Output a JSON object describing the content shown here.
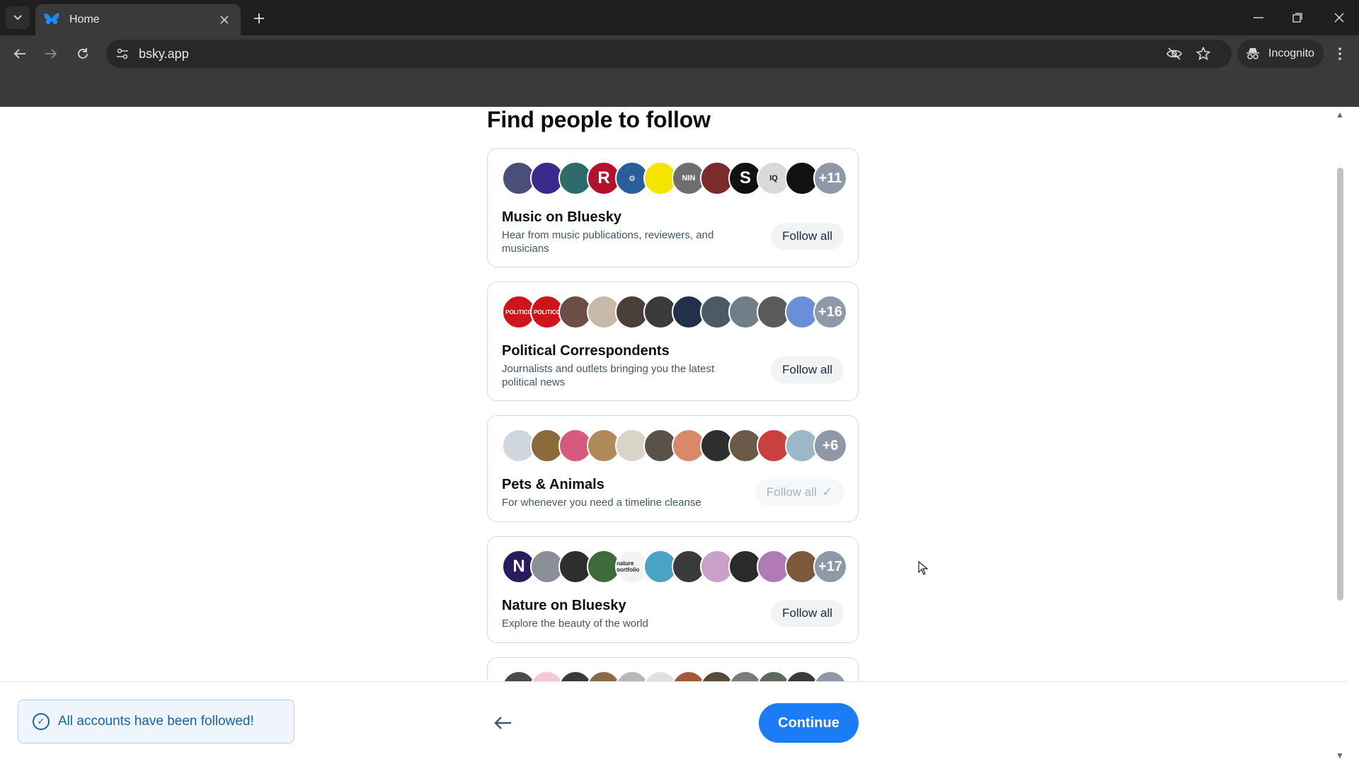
{
  "browser": {
    "tab_title": "Home",
    "url": "bsky.app",
    "incognito_label": "Incognito"
  },
  "page": {
    "heading": "Find people to follow"
  },
  "cards": [
    {
      "title": "Music on Bluesky",
      "description": "Hear from music publications, reviewers, and musicians",
      "more_count": "+11",
      "follow_label": "Follow all",
      "followed": false,
      "avatar_colors": [
        "#4a4f7a",
        "#3b2a8e",
        "#2f6b6a",
        "#b3122e",
        "#2a5e9a",
        "#f5e400",
        "#6e6e6e",
        "#7a2c2c",
        "#111111",
        "#d9d9d9",
        "#111111"
      ],
      "avatar_labels": [
        "",
        "",
        "",
        "R",
        "⚙",
        "",
        "NIN",
        "",
        "S",
        "IQ",
        ""
      ]
    },
    {
      "title": "Political Correspondents",
      "description": "Journalists and outlets bringing you the latest political news",
      "more_count": "+16",
      "follow_label": "Follow all",
      "followed": false,
      "avatar_colors": [
        "#d0141c",
        "#d0141c",
        "#6b4f45",
        "#c9b9a8",
        "#4a3f3a",
        "#3b3b3b",
        "#22304a",
        "#4e5966",
        "#6f7f88",
        "#5a5a5a",
        "#6a8fd8"
      ],
      "avatar_labels": [
        "POLITICO",
        "POLITICO",
        "",
        "",
        "",
        "",
        "",
        "",
        "",
        "",
        ""
      ]
    },
    {
      "title": "Pets & Animals",
      "description": "For whenever you need a timeline cleanse",
      "more_count": "+6",
      "follow_label": "Follow all",
      "followed": true,
      "avatar_colors": [
        "#cfd6de",
        "#8a6b3a",
        "#d65a7e",
        "#b08a5a",
        "#d9d4c8",
        "#5a5148",
        "#d9886a",
        "#2e2e2e",
        "#6b5a48",
        "#c94040",
        "#9ab8c8"
      ],
      "avatar_labels": [
        "",
        "",
        "",
        "",
        "",
        "",
        "",
        "",
        "",
        "",
        ""
      ]
    },
    {
      "title": "Nature on Bluesky",
      "description": "Explore the beauty of the world",
      "more_count": "+17",
      "follow_label": "Follow all",
      "followed": false,
      "avatar_colors": [
        "#2a1a5e",
        "#8a8f96",
        "#2e2e2e",
        "#3e6b3a",
        "#f3f3f3",
        "#4aa3c4",
        "#3a3a3a",
        "#c9a0c8",
        "#2a2a2a",
        "#b07ab8",
        "#7a5a3a"
      ],
      "avatar_labels": [
        "N",
        "",
        "",
        "",
        "nature portfolio",
        "",
        "",
        "",
        "",
        "",
        ""
      ]
    }
  ],
  "footer": {
    "toast_text": "All accounts have been followed!",
    "continue_label": "Continue"
  }
}
